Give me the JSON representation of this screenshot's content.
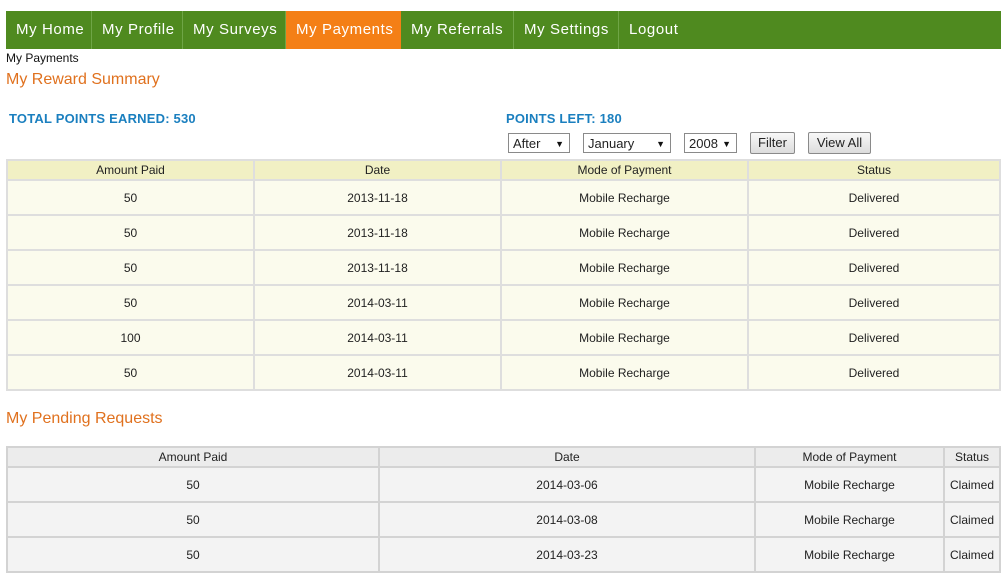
{
  "nav": {
    "items": [
      {
        "label": "My Home"
      },
      {
        "label": "My Profile"
      },
      {
        "label": "My Surveys"
      },
      {
        "label": "My Payments"
      },
      {
        "label": "My Referrals"
      },
      {
        "label": "My Settings"
      },
      {
        "label": "Logout"
      }
    ],
    "active": "My Payments",
    "bar_color": "#4f8a1f",
    "active_color": "#f47f16"
  },
  "breadcrumb": "My Payments",
  "reward_summary": {
    "title": "My Reward Summary",
    "total_points_earned": "TOTAL POINTS EARNED: 530",
    "points_left": "POINTS LEFT: 180",
    "filter": {
      "condition": "After",
      "month": "January",
      "year": "2008",
      "filter_label": "Filter",
      "view_all_label": "View All"
    },
    "columns": [
      "Amount Paid",
      "Date",
      "Mode of Payment",
      "Status"
    ],
    "rows": [
      [
        "50",
        "2013-11-18",
        "Mobile Recharge",
        "Delivered"
      ],
      [
        "50",
        "2013-11-18",
        "Mobile Recharge",
        "Delivered"
      ],
      [
        "50",
        "2013-11-18",
        "Mobile Recharge",
        "Delivered"
      ],
      [
        "50",
        "2014-03-11",
        "Mobile Recharge",
        "Delivered"
      ],
      [
        "100",
        "2014-03-11",
        "Mobile Recharge",
        "Delivered"
      ],
      [
        "50",
        "2014-03-11",
        "Mobile Recharge",
        "Delivered"
      ]
    ]
  },
  "pending_requests": {
    "title": "My Pending Requests",
    "columns": [
      "Amount Paid",
      "Date",
      "Mode of Payment",
      "Status"
    ],
    "rows": [
      [
        "50",
        "2014-03-06",
        "Mobile Recharge",
        "Claimed"
      ],
      [
        "50",
        "2014-03-08",
        "Mobile Recharge",
        "Claimed"
      ],
      [
        "50",
        "2014-03-23",
        "Mobile Recharge",
        "Claimed"
      ]
    ]
  },
  "colors": {
    "section_title": "#e0711e",
    "points_text": "#1a7fbf"
  }
}
